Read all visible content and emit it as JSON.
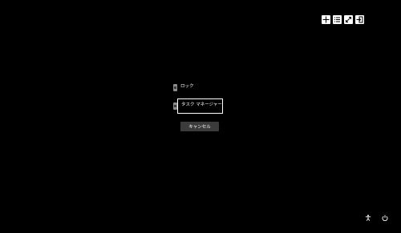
{
  "toolbar": {
    "icons": [
      "move-icon",
      "list-icon",
      "expand-icon",
      "sign-in-icon"
    ]
  },
  "menu": {
    "lock_label": "ロック",
    "task_manager_label": "タスク マネージャー"
  },
  "cancel_label": "キャンセル",
  "bottom": {
    "icons": [
      "accessibility-icon",
      "power-icon"
    ]
  },
  "colors": {
    "background": "#000000",
    "text": "#ffffff",
    "button": "#3b3b3b",
    "icon_chip": "#8c8c8c"
  }
}
